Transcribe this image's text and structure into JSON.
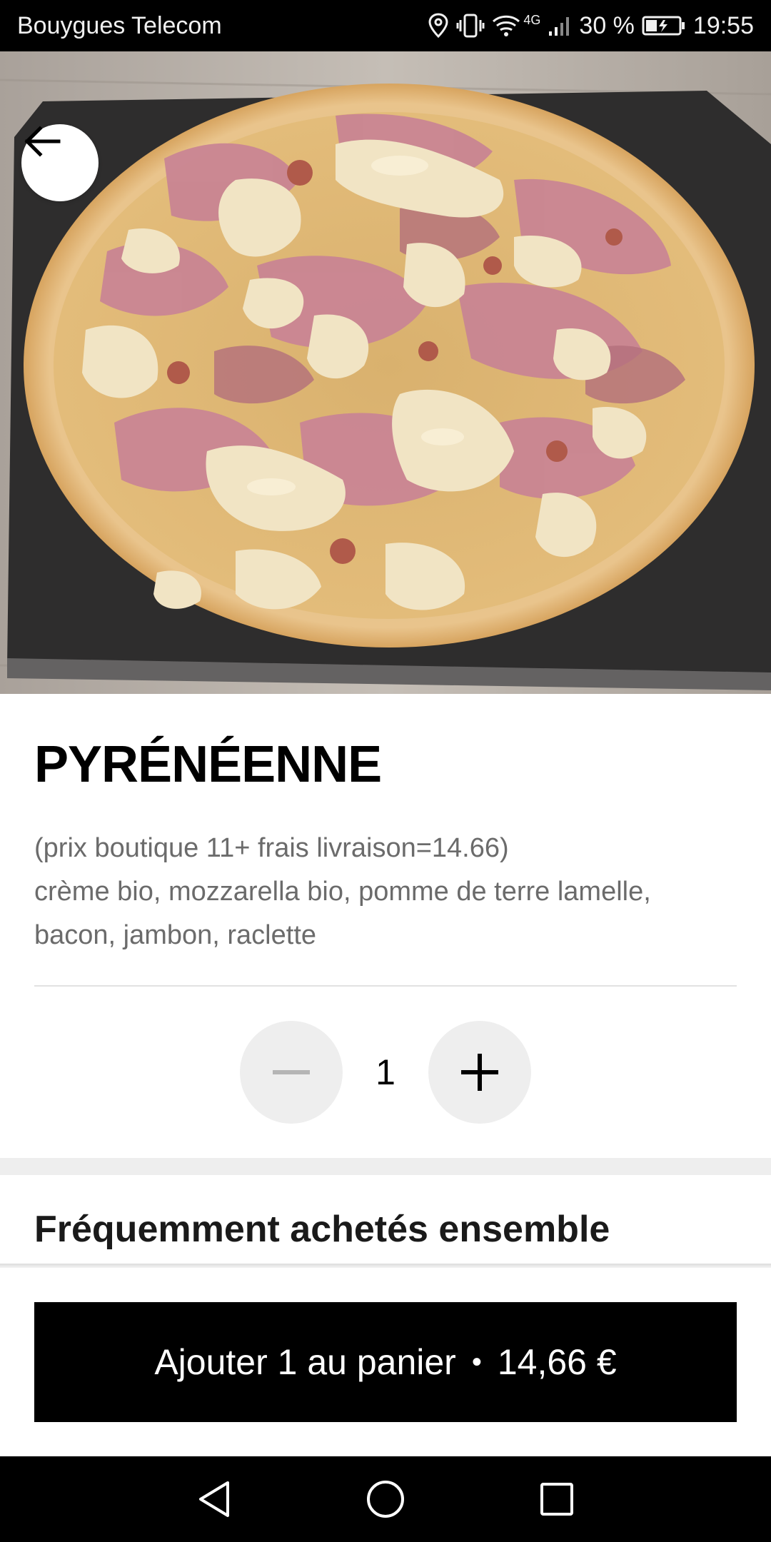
{
  "status_bar": {
    "carrier": "Bouygues Telecom",
    "network": "4G",
    "battery": "30 %",
    "time": "19:55",
    "icons": [
      "location-icon",
      "vibrate-icon",
      "wifi-icon",
      "signal-icon",
      "battery-icon"
    ]
  },
  "product": {
    "title": "PYRÉNÉENNE",
    "description_lines": [
      "(prix boutique 11+ frais livraison=14.66)",
      "crème bio, mozzarella bio, pomme de terre lamelle,",
      "bacon, jambon, raclette"
    ],
    "quantity": "1"
  },
  "section": {
    "title": "Fréquemment achetés ensemble"
  },
  "cta": {
    "label": "Ajouter 1 au panier",
    "separator": "•",
    "price": "14,66 €"
  },
  "colors": {
    "primary": "#000000",
    "muted_text": "#6b6b6b",
    "stepper_bg": "#eeeeee"
  }
}
